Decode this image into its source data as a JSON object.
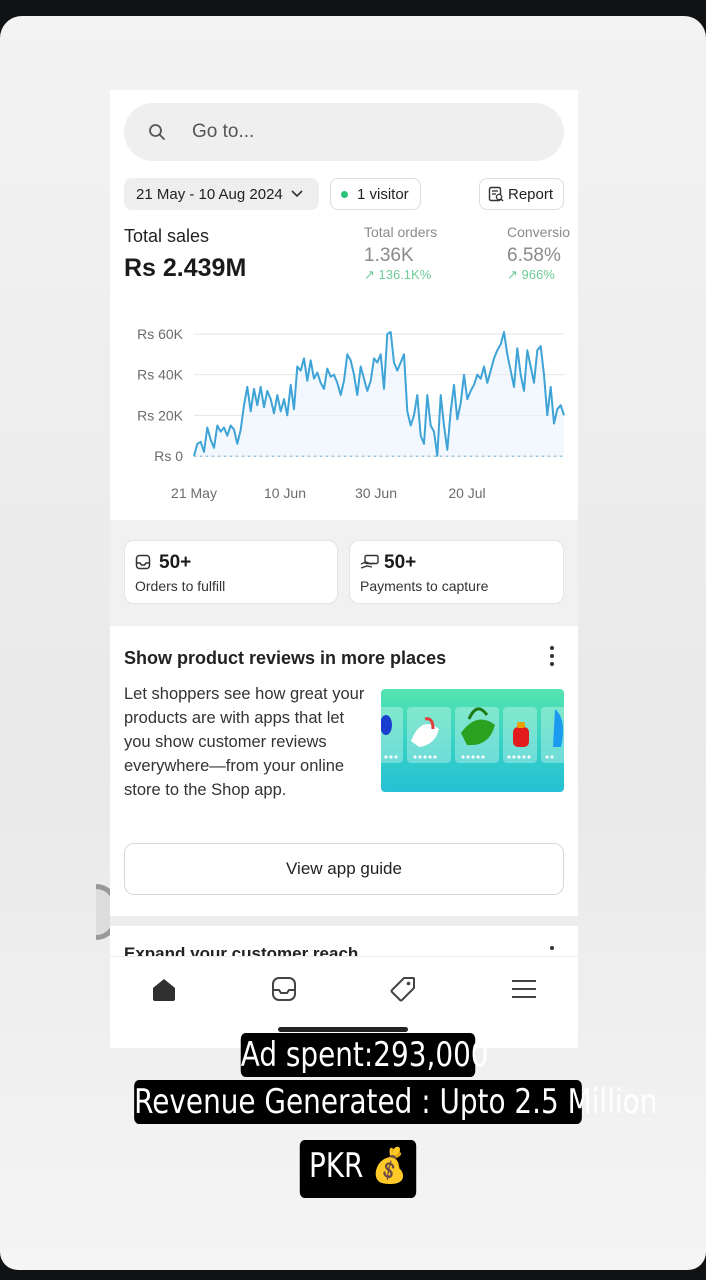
{
  "search": {
    "placeholder": "Go to..."
  },
  "filters": {
    "date_range": "21 May - 10 Aug 2024",
    "visitors": "1 visitor",
    "report_label": "Report"
  },
  "metrics": {
    "total_sales_label": "Total sales",
    "total_sales_value": "Rs 2.439M",
    "total_orders_label": "Total orders",
    "total_orders_value": "1.36K",
    "total_orders_change": "↗ 136.1K%",
    "conversion_label": "Conversio",
    "conversion_value": "6.58%",
    "conversion_change": "↗ 966%"
  },
  "chart_data": {
    "type": "line",
    "ylim": [
      0,
      60000
    ],
    "y_ticks": [
      "Rs 60K",
      "Rs 40K",
      "Rs 20K",
      "Rs 0"
    ],
    "x_ticks": [
      "21 May",
      "10 Jun",
      "30 Jun",
      "20 Jul"
    ],
    "grid": true,
    "series": [
      {
        "values": [
          0,
          6000,
          7000,
          2000,
          14000,
          8000,
          4000,
          15000,
          12000,
          14000,
          10000,
          15000,
          13000,
          6000,
          13000,
          25000,
          34000,
          22000,
          33000,
          25000,
          34000,
          24000,
          32000,
          28000,
          21000,
          30000,
          22000,
          28000,
          20000,
          35000,
          23000,
          44000,
          42000,
          48000,
          37000,
          47000,
          38000,
          41000,
          36000,
          33000,
          43000,
          39000,
          40000,
          36000,
          30000,
          37000,
          50000,
          47000,
          40000,
          30000,
          44000,
          38000,
          32000,
          37000,
          48000,
          46000,
          50000,
          33000,
          60000,
          61000,
          46000,
          42000,
          46000,
          50000,
          22000,
          15000,
          20000,
          30000,
          10000,
          6000,
          30000,
          15000,
          12000,
          0,
          30000,
          15000,
          3000,
          22000,
          35000,
          18000,
          26000,
          40000,
          28000,
          32000,
          35000,
          40000,
          38000,
          44000,
          36000,
          42000,
          48000,
          52000,
          55000,
          61000,
          50000,
          42000,
          34000,
          53000,
          40000,
          32000,
          52000,
          44000,
          36000,
          52000,
          54000,
          40000,
          20000,
          34000,
          16000,
          23000,
          25000,
          20000
        ]
      },
      {
        "style": "dotted",
        "values": [
          0,
          0,
          0,
          0,
          0,
          0,
          0,
          0,
          0,
          0,
          0,
          0
        ]
      }
    ]
  },
  "cards": {
    "orders_count": "50+",
    "orders_label": "Orders to fulfill",
    "payments_count": "50+",
    "payments_label": "Payments to capture"
  },
  "promo": {
    "title": "Show product reviews in more places",
    "body": "Let shoppers see how great your products are with apps that let you show customer reviews everywhere—from your online store to the Shop app.",
    "button": "View app guide"
  },
  "next_section": {
    "title": "Expand your customer reach"
  },
  "captions": {
    "line1": "Ad spent:293,000",
    "line2": "Revenue Generated : Upto 2.5 Million",
    "line3": "PKR 💰"
  },
  "colors": {
    "chart_line": "#3ea3d6",
    "accent_green": "#29c07a"
  }
}
